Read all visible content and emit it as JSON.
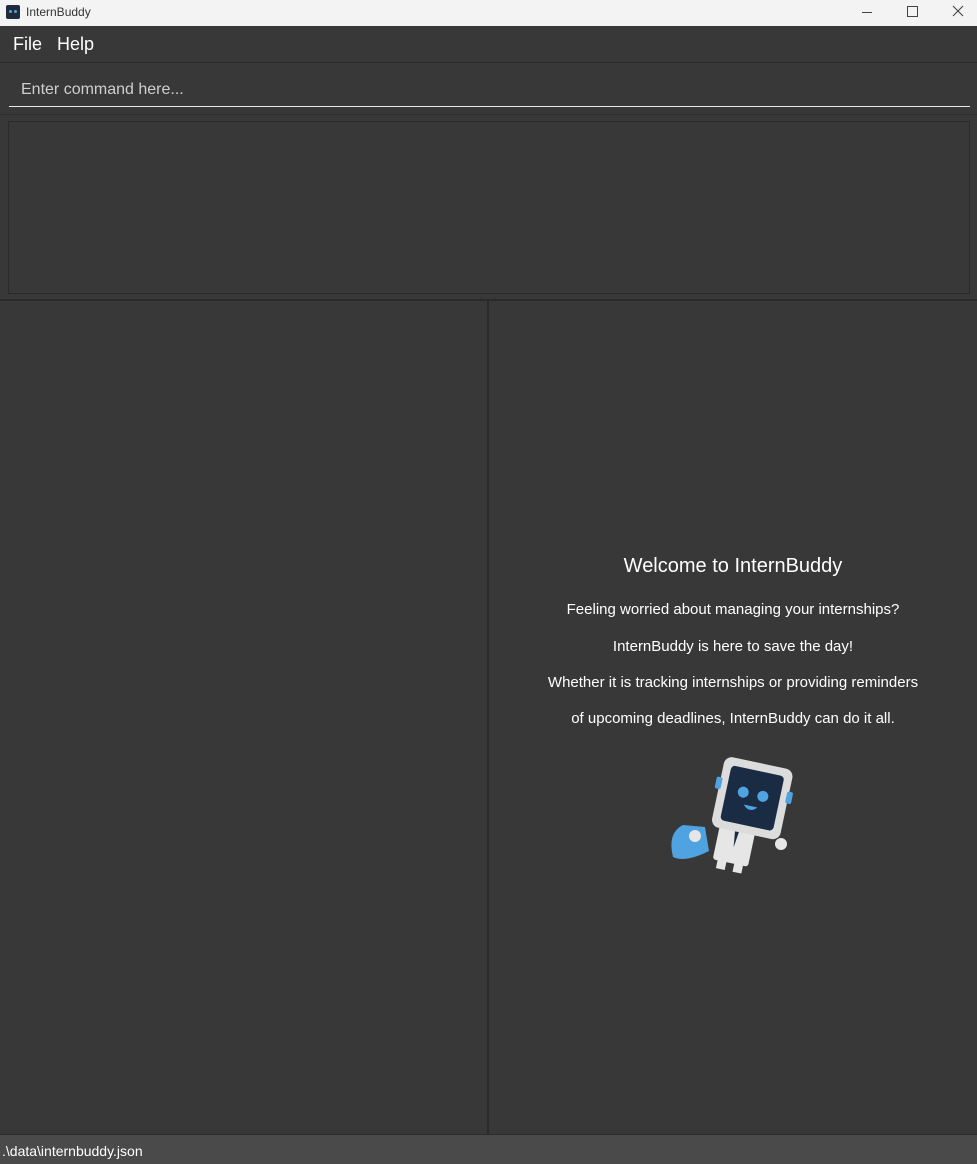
{
  "window": {
    "title": "InternBuddy",
    "icon": "app-robot-icon",
    "controls": [
      "minimize-icon",
      "maximize-icon",
      "close-icon"
    ]
  },
  "menu": {
    "file_label": "File",
    "help_label": "Help"
  },
  "command": {
    "placeholder": "Enter command here...",
    "value": ""
  },
  "result_display": {
    "text": ""
  },
  "welcome": {
    "title": "Welcome to InternBuddy",
    "lines": [
      "Feeling worried about managing your internships?",
      "InternBuddy is here to save the day!",
      "Whether it is tracking internships or providing reminders",
      "of upcoming deadlines, InternBuddy can do it all."
    ],
    "mascot_icon": "robot-mascot-icon"
  },
  "status": {
    "file_path": ".\\data\\internbuddy.json"
  },
  "colors": {
    "background": "#383838",
    "titlebar": "#f3f3f3",
    "statusbar": "#4a4a4a",
    "accent_blue": "#4fa3e0",
    "mascot_screen": "#1a2c44"
  }
}
